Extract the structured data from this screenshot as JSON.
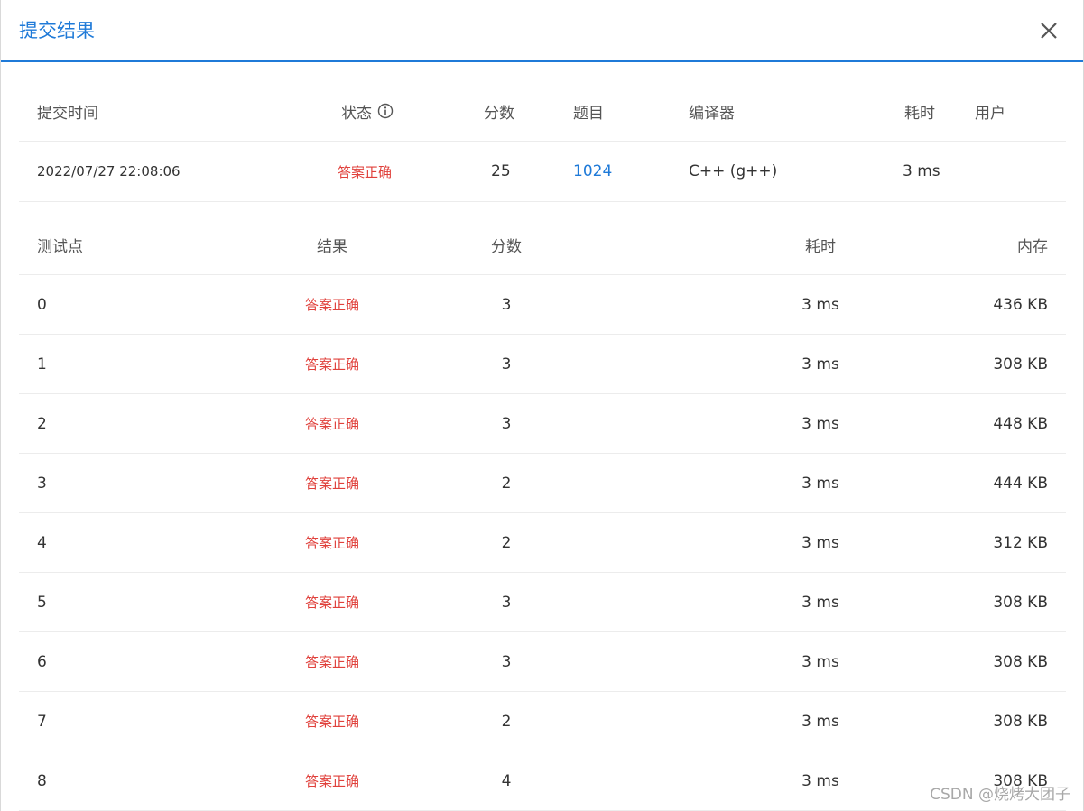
{
  "dialog": {
    "title": "提交结果"
  },
  "summary": {
    "headers": {
      "submit_time": "提交时间",
      "status": "状态",
      "score": "分数",
      "problem": "题目",
      "compiler": "编译器",
      "time": "耗时",
      "user": "用户"
    },
    "row": {
      "submit_time": "2022/07/27 22:08:06",
      "status": "答案正确",
      "score": "25",
      "problem": "1024",
      "compiler": "C++ (g++)",
      "time": "3 ms",
      "user": ""
    }
  },
  "cases": {
    "headers": {
      "case": "测试点",
      "result": "结果",
      "score": "分数",
      "time": "耗时",
      "memory": "内存"
    },
    "rows": [
      {
        "case": "0",
        "result": "答案正确",
        "score": "3",
        "time": "3 ms",
        "memory": "436 KB"
      },
      {
        "case": "1",
        "result": "答案正确",
        "score": "3",
        "time": "3 ms",
        "memory": "308 KB"
      },
      {
        "case": "2",
        "result": "答案正确",
        "score": "3",
        "time": "3 ms",
        "memory": "448 KB"
      },
      {
        "case": "3",
        "result": "答案正确",
        "score": "2",
        "time": "3 ms",
        "memory": "444 KB"
      },
      {
        "case": "4",
        "result": "答案正确",
        "score": "2",
        "time": "3 ms",
        "memory": "312 KB"
      },
      {
        "case": "5",
        "result": "答案正确",
        "score": "3",
        "time": "3 ms",
        "memory": "308 KB"
      },
      {
        "case": "6",
        "result": "答案正确",
        "score": "3",
        "time": "3 ms",
        "memory": "308 KB"
      },
      {
        "case": "7",
        "result": "答案正确",
        "score": "2",
        "time": "3 ms",
        "memory": "308 KB"
      },
      {
        "case": "8",
        "result": "答案正确",
        "score": "4",
        "time": "3 ms",
        "memory": "308 KB"
      }
    ]
  },
  "watermark": "CSDN @烧烤大团子",
  "colors": {
    "accent": "#1f7ad8",
    "status_ok": "#e0403b"
  },
  "icons": {
    "close": "close-icon",
    "status_info": "info-icon"
  }
}
